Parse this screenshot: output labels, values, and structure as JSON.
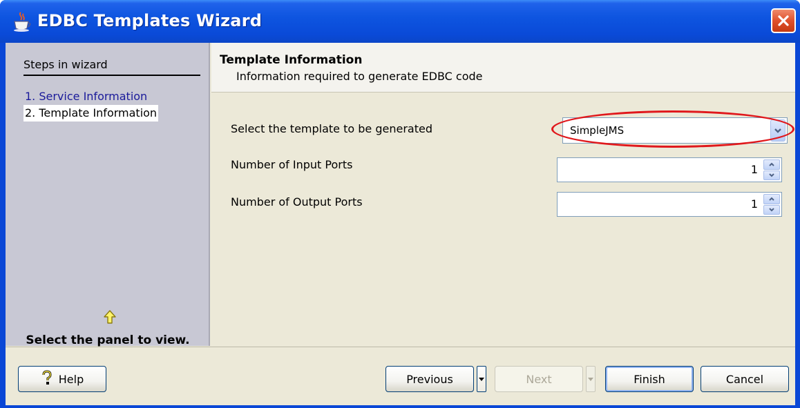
{
  "window": {
    "title": "EDBC Templates Wizard",
    "icon": "java-cup-icon",
    "close_icon": "close-icon"
  },
  "steps": {
    "title": "Steps in wizard",
    "items": [
      {
        "label": "1. Service Information",
        "state": "done"
      },
      {
        "label": "2. Template Information",
        "state": "current"
      }
    ],
    "hint_icon": "up-arrow-icon",
    "hint": "Select the panel to view."
  },
  "header": {
    "title": "Template Information",
    "subtitle": "Information required to generate EDBC code"
  },
  "form": {
    "template_label": "Select the template to be generated",
    "template_value": "SimpleJMS",
    "input_ports_label": "Number of Input Ports",
    "input_ports_value": "1",
    "output_ports_label": "Number of Output Ports",
    "output_ports_value": "1"
  },
  "buttons": {
    "help": "Help",
    "previous": "Previous",
    "next": "Next",
    "finish": "Finish",
    "cancel": "Cancel"
  },
  "colors": {
    "titlebar": "#0a4ad8",
    "highlight": "#e0181c",
    "steps_panel": "#c8c8d4",
    "client": "#ece9d8"
  }
}
